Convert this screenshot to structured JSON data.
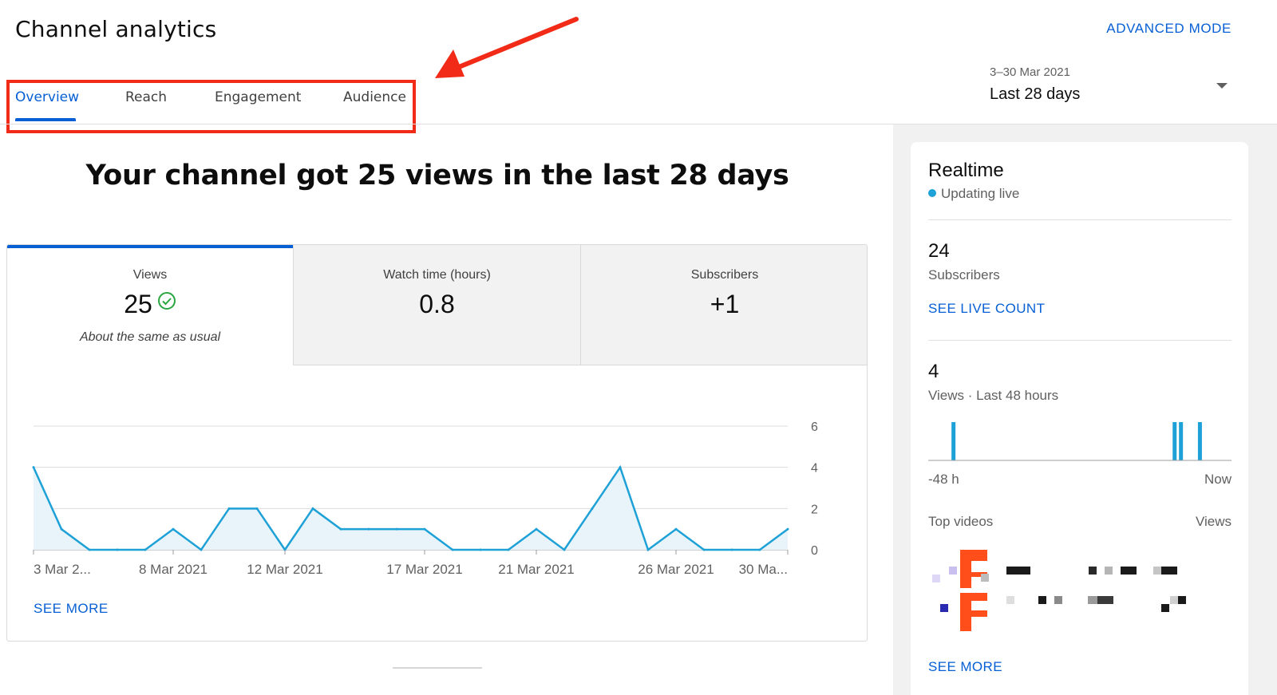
{
  "header": {
    "title": "Channel analytics",
    "advanced_mode": "ADVANCED MODE"
  },
  "tabs": [
    {
      "label": "Overview",
      "active": true
    },
    {
      "label": "Reach",
      "active": false
    },
    {
      "label": "Engagement",
      "active": false
    },
    {
      "label": "Audience",
      "active": false
    }
  ],
  "date_picker": {
    "range": "3–30 Mar 2021",
    "label": "Last 28 days"
  },
  "headline": "Your channel got 25 views in the last 28 days",
  "metrics": [
    {
      "label": "Views",
      "value": "25",
      "note": "About the same as usual",
      "active": true,
      "status_icon": "check-circle-icon"
    },
    {
      "label": "Watch time (hours)",
      "value": "0.8",
      "active": false
    },
    {
      "label": "Subscribers",
      "value": "+1",
      "active": false
    }
  ],
  "chart_data": {
    "type": "area",
    "series": [
      {
        "values": [
          4,
          1,
          0,
          0,
          0,
          1,
          0,
          2,
          2,
          0,
          2,
          1,
          1,
          1,
          1,
          0,
          0,
          0,
          1,
          0,
          2,
          4,
          0,
          1,
          0,
          0,
          0,
          1
        ]
      }
    ],
    "x_tick_labels": [
      "3 Mar 2...",
      "8 Mar 2021",
      "12 Mar 2021",
      "17 Mar 2021",
      "21 Mar 2021",
      "26 Mar 2021",
      "30 Ma..."
    ],
    "x_tick_days": [
      3,
      8,
      12,
      17,
      21,
      26,
      30
    ],
    "y_ticks": [
      "6",
      "4",
      "2",
      "0"
    ],
    "ylim": [
      0,
      6
    ],
    "grid": true,
    "line_color": "#1ea1d6",
    "fill_color": "#e8f4fa"
  },
  "see_more": "SEE MORE",
  "realtime": {
    "title": "Realtime",
    "status": "Updating live",
    "subscribers_value": "24",
    "subscribers_label": "Subscribers",
    "see_live_count": "SEE LIVE COUNT",
    "views_value": "4",
    "views_label": "Views · Last 48 hours",
    "spark_hours_before_now": [
      44,
      9,
      8,
      5
    ],
    "axis_start": "-48 h",
    "axis_end": "Now",
    "top_videos_label": "Top videos",
    "views_col_label": "Views",
    "see_more": "SEE MORE"
  },
  "colors": {
    "accent": "#065fd4",
    "annotation": "#f22a18",
    "chart_line": "#1ea1d6",
    "live_dot": "#1ea1d6",
    "positive": "#2ba640"
  }
}
